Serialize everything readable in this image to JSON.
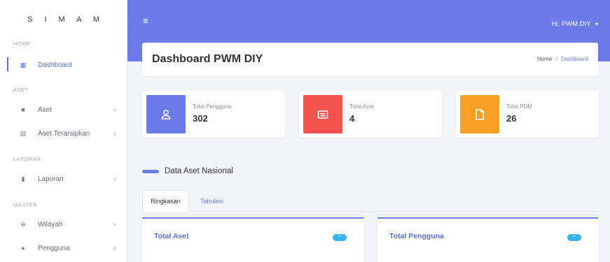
{
  "sidebar": {
    "brand": "S I M A M",
    "sections": {
      "home": "HOME",
      "aset": "ASET",
      "laporan": "LAPORAN",
      "master": "MASTER"
    },
    "items": {
      "dashboard": "Dashboard",
      "aset": "Aset",
      "aset_terarsipkan": "Aset Terarsipkan",
      "laporan": "Laporan",
      "wilayah": "Wilayah",
      "pengguna": "Pengguna"
    }
  },
  "topbar": {
    "menu_icon": "≡",
    "user_greeting": "Hi, PWM DIY",
    "dropdown_caret": "▾"
  },
  "page": {
    "title": "Dashboard PWM DIY",
    "breadcrumb": [
      "Home",
      "Dashboard"
    ],
    "breadcrumb_sep": "/"
  },
  "stats": [
    {
      "label": "Total Pengguna",
      "value": "302",
      "color": "#6b7be8",
      "icon": "user-icon"
    },
    {
      "label": "Total Aset",
      "value": "4",
      "color": "#f5544e",
      "icon": "asset-card-icon"
    },
    {
      "label": "Total PDM",
      "value": "26",
      "color": "#f7a024",
      "icon": "document-icon"
    }
  ],
  "section": {
    "title": "Data Aset Nasional"
  },
  "tabs": {
    "ringkasan": "Ringkasan",
    "tabulasi": "Tabulasi"
  },
  "panels": {
    "total_aset": "Total Aset",
    "total_pengguna": "Total Pengguna"
  },
  "colors": {
    "accent": "#6b7be8",
    "info": "#3ab3ea"
  }
}
